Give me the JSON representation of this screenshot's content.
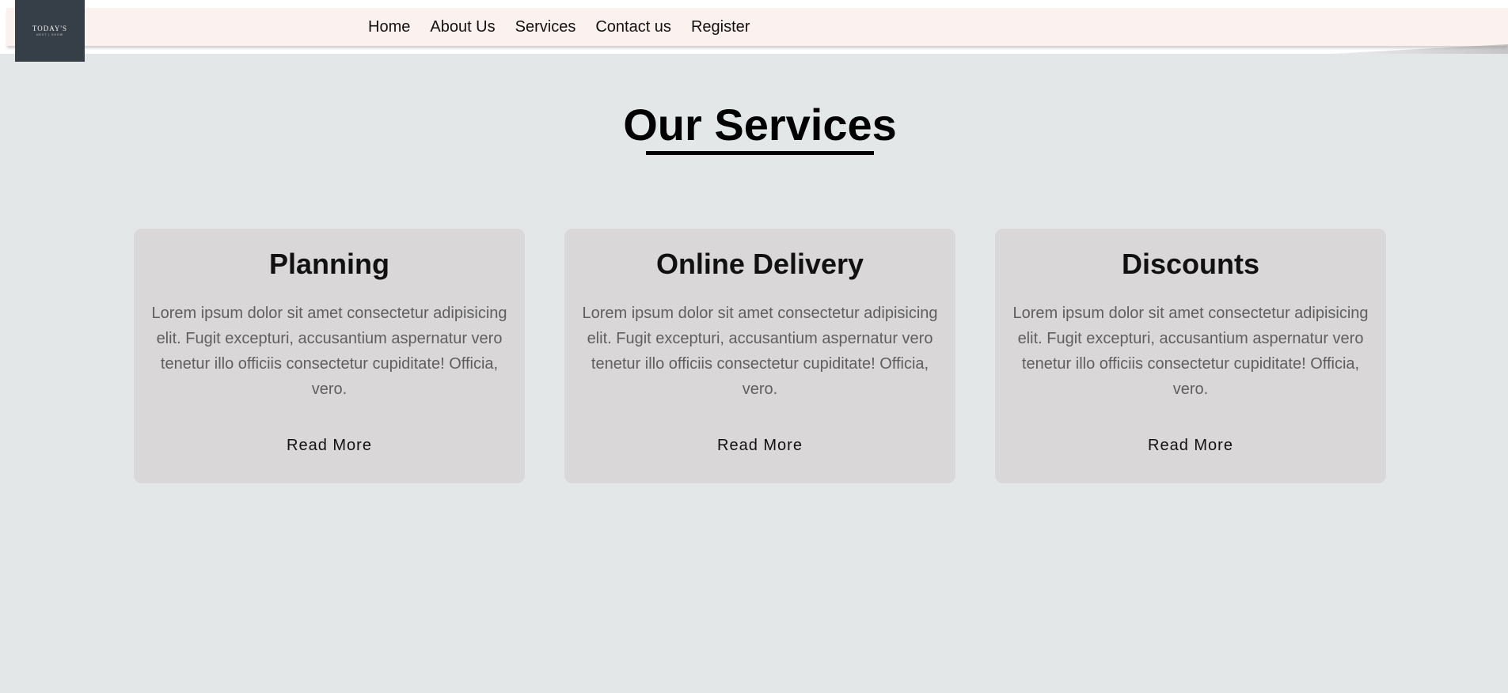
{
  "logo": {
    "main": "TODAY'S",
    "sub": "NEXT | SHOW"
  },
  "nav": {
    "items": [
      {
        "label": "Home"
      },
      {
        "label": "About Us"
      },
      {
        "label": "Services"
      },
      {
        "label": "Contact us"
      },
      {
        "label": "Register"
      }
    ]
  },
  "main": {
    "title": "Our Services",
    "cards": [
      {
        "title": "Planning",
        "text": "Lorem ipsum dolor sit amet consectetur adipisicing elit. Fugit excepturi, accusantium aspernatur vero tenetur illo officiis consectetur cupiditate! Officia, vero.",
        "button": "Read More"
      },
      {
        "title": "Online Delivery",
        "text": "Lorem ipsum dolor sit amet consectetur adipisicing elit. Fugit excepturi, accusantium aspernatur vero tenetur illo officiis consectetur cupiditate! Officia, vero.",
        "button": "Read More"
      },
      {
        "title": "Discounts",
        "text": "Lorem ipsum dolor sit amet consectetur adipisicing elit. Fugit excepturi, accusantium aspernatur vero tenetur illo officiis consectetur cupiditate! Officia, vero.",
        "button": "Read More"
      }
    ]
  },
  "colors": {
    "background": "#e3e7e8",
    "header": "#fbf1ef",
    "card": "#d9d7d8",
    "logo": "#363f47"
  }
}
